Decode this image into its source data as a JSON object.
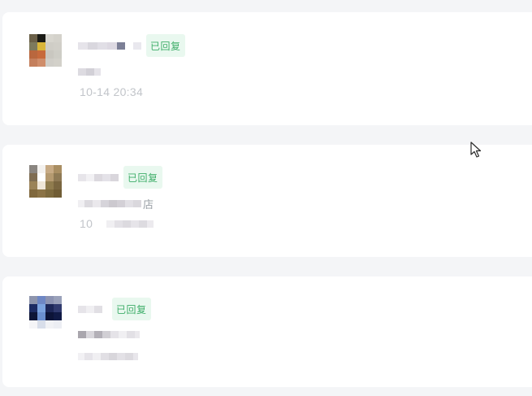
{
  "messages": [
    {
      "status_badge": "已回复",
      "time": "10-14 20:34",
      "content_text": ""
    },
    {
      "status_badge": "已回复",
      "time": "10",
      "content_text": "店"
    },
    {
      "status_badge": "已回复",
      "time": "",
      "content_text": ""
    }
  ],
  "colors": {
    "page_bg": "#f4f5f7",
    "card_bg": "#ffffff",
    "badge_bg": "#e9f8ef",
    "badge_text": "#3fae6a",
    "time_text": "#c2c5ca"
  },
  "icons": {
    "cursor": "arrow-cursor-icon"
  }
}
